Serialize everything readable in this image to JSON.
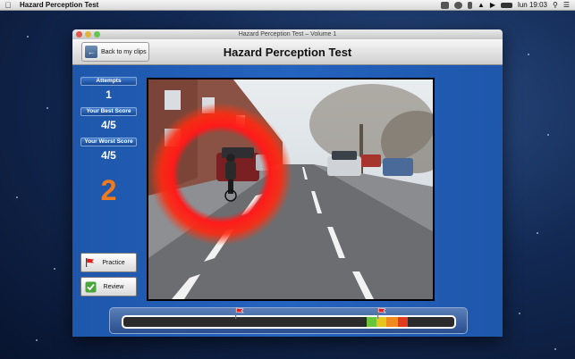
{
  "menubar": {
    "app_name": "Hazard Perception Test",
    "clock": "lun 19:03",
    "icons": [
      "apple-icon",
      "status-icon",
      "time-machine-icon",
      "bluetooth-icon",
      "wifi-icon",
      "volume-icon",
      "battery-icon",
      "spotlight-icon",
      "notification-icon"
    ]
  },
  "window": {
    "title": "Hazard Perception Test – Volume 1",
    "header_title": "Hazard Perception Test",
    "back_label": "Back to my clips"
  },
  "stats": {
    "attempts_label": "Attempts",
    "attempts_value": "1",
    "best_label": "Your Best Score",
    "best_value": "4/5",
    "worst_label": "Your Worst Score",
    "worst_value": "4/5",
    "current_score": "2"
  },
  "buttons": {
    "practice_label": "Practice",
    "review_label": "Review"
  },
  "timeline": {
    "user_flag_position": 0.34,
    "target_flag_position": 0.77,
    "zones": [
      {
        "start": 0.735,
        "end": 0.765,
        "color": "#6ac43a"
      },
      {
        "start": 0.765,
        "end": 0.795,
        "color": "#e6c61e"
      },
      {
        "start": 0.795,
        "end": 0.83,
        "color": "#f08a1e"
      },
      {
        "start": 0.83,
        "end": 0.86,
        "color": "#e23a1e"
      }
    ]
  },
  "colors": {
    "accent_orange": "#f07b1e",
    "window_blue": "#1f5bb0",
    "hazard_ring": "#ff1a1a"
  }
}
